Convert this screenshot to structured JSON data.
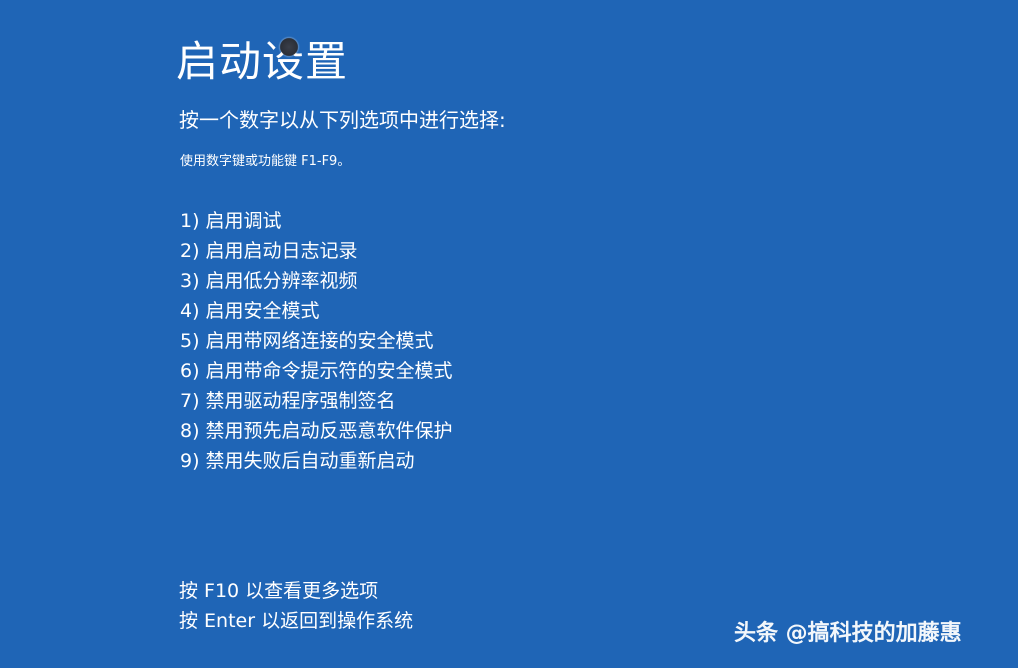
{
  "title": "启动设置",
  "instruction": "按一个数字以从下列选项中进行选择:",
  "hint": "使用数字键或功能键 F1-F9。",
  "options": [
    "1) 启用调试",
    "2) 启用启动日志记录",
    "3) 启用低分辨率视频",
    "4) 启用安全模式",
    "5) 启用带网络连接的安全模式",
    "6) 启用带命令提示符的安全模式",
    "7) 禁用驱动程序强制签名",
    "8) 禁用预先启动反恶意软件保护",
    "9) 禁用失败后自动重新启动"
  ],
  "footer": {
    "more_options": "按 F10 以查看更多选项",
    "return": "按 Enter 以返回到操作系统"
  },
  "watermark": "头条 @搞科技的加藤惠",
  "colors": {
    "background": "#1f65b6",
    "text": "#ffffff"
  }
}
